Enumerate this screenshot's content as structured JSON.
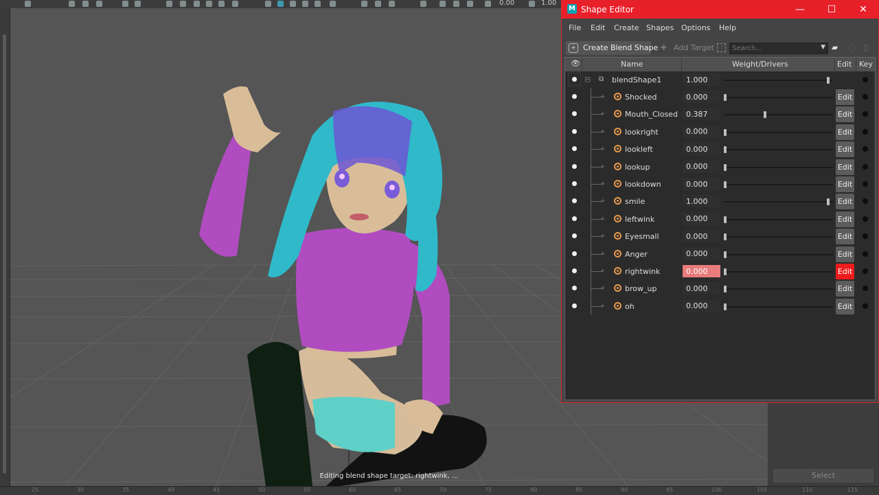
{
  "maya": {
    "toolbar_values": [
      "0.00",
      "1.00"
    ],
    "viewport_caption": "Editing blend shape target: rightwink, ...",
    "right_panel": {
      "select_label": "Select"
    },
    "ruler_labels": [
      "25",
      "30",
      "35",
      "40",
      "45",
      "50",
      "55",
      "60",
      "65",
      "70",
      "75",
      "80",
      "85",
      "90",
      "95",
      "100",
      "105",
      "110",
      "115"
    ]
  },
  "window": {
    "title": "Shape Editor",
    "app_icon": "M",
    "controls": {
      "minimize": "—",
      "maximize": "☐",
      "close": "✕"
    },
    "accent": "#e8202a"
  },
  "menu": [
    "File",
    "Edit",
    "Create",
    "Shapes",
    "Options",
    "Help"
  ],
  "toolbar": {
    "create_blend_shape": "Create Blend Shape",
    "add_target": "Add Target",
    "search_placeholder": "Search..."
  },
  "table": {
    "headers": {
      "name": "Name",
      "weight": "Weight/Drivers",
      "edit": "Edit",
      "key": "Key"
    },
    "blendshape": {
      "name": "blendShape1",
      "weight": "1.000",
      "weight_fraction": 1.0
    },
    "edit_label": "Edit",
    "targets": [
      {
        "name": "Shocked",
        "weight": "0.000",
        "weight_fraction": 0.0
      },
      {
        "name": "Mouth_Closed",
        "weight": "0.387",
        "weight_fraction": 0.387
      },
      {
        "name": "lookright",
        "weight": "0.000",
        "weight_fraction": 0.0
      },
      {
        "name": "lookleft",
        "weight": "0.000",
        "weight_fraction": 0.0
      },
      {
        "name": "lookup",
        "weight": "0.000",
        "weight_fraction": 0.0
      },
      {
        "name": "lookdown",
        "weight": "0.000",
        "weight_fraction": 0.0
      },
      {
        "name": "smile",
        "weight": "1.000",
        "weight_fraction": 1.0
      },
      {
        "name": "leftwink",
        "weight": "0.000",
        "weight_fraction": 0.0
      },
      {
        "name": "Eyesmall",
        "weight": "0.000",
        "weight_fraction": 0.0
      },
      {
        "name": "Anger",
        "weight": "0.000",
        "weight_fraction": 0.0
      },
      {
        "name": "rightwink",
        "weight": "0.000",
        "weight_fraction": 0.0,
        "editing": true
      },
      {
        "name": "brow_up",
        "weight": "0.000",
        "weight_fraction": 0.0
      },
      {
        "name": "oh",
        "weight": "0.000",
        "weight_fraction": 0.0
      }
    ]
  }
}
